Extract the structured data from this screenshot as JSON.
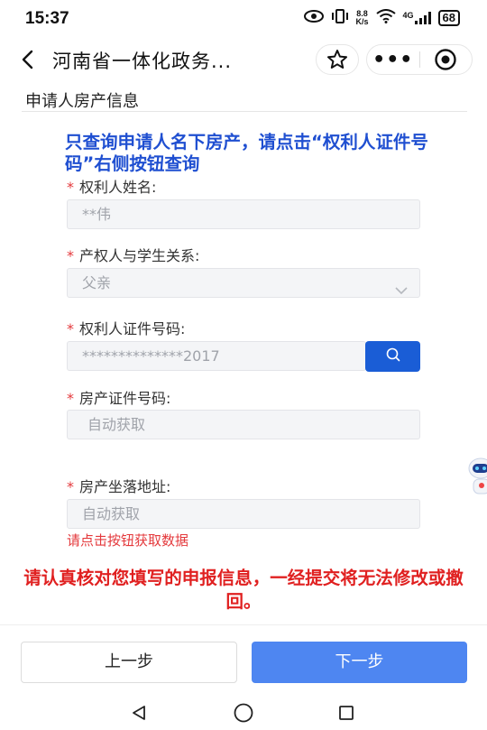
{
  "status_bar": {
    "time": "15:37",
    "net_speed_top": "8.8",
    "net_speed_bottom": "K/s",
    "network_type": "4G",
    "battery": "68"
  },
  "nav": {
    "title": "河南省一体化政务...",
    "more": "•••"
  },
  "section": {
    "title": "申请人房产信息"
  },
  "notice": "只查询申请人名下房产，请点击“权利人证件号码”右侧按钮查询",
  "form": {
    "required_mark": "*",
    "owner_name": {
      "label": "权利人姓名:",
      "value": "**伟"
    },
    "relation": {
      "label": "产权人与学生关系:",
      "value": "父亲"
    },
    "id_number": {
      "label": "权利人证件号码:",
      "value": "**************2017"
    },
    "cert_number": {
      "label": "房产证件号码:",
      "placeholder": "自动获取"
    },
    "address": {
      "label": "房产坐落地址:",
      "placeholder": "自动获取"
    },
    "hint": "请点击按钮获取数据"
  },
  "warning": "请认真核对您填写的申报信息，一经提交将无法修改或撤回。",
  "buttons": {
    "prev": "上一步",
    "next": "下一步"
  },
  "colors": {
    "primary_blue": "#1a5dd6",
    "next_button": "#4e86f1",
    "notice_blue": "#1f4fd1",
    "warning_red": "#e02020"
  },
  "icons": [
    "eye-icon",
    "vibrate-icon",
    "wifi-icon",
    "signal-icon",
    "battery-icon",
    "back-arrow-icon",
    "star-icon",
    "more-icon",
    "close-target-icon",
    "search-icon",
    "chevron-down-icon",
    "robot-assistant-icon",
    "nav-back-icon",
    "nav-home-icon",
    "nav-recents-icon"
  ]
}
